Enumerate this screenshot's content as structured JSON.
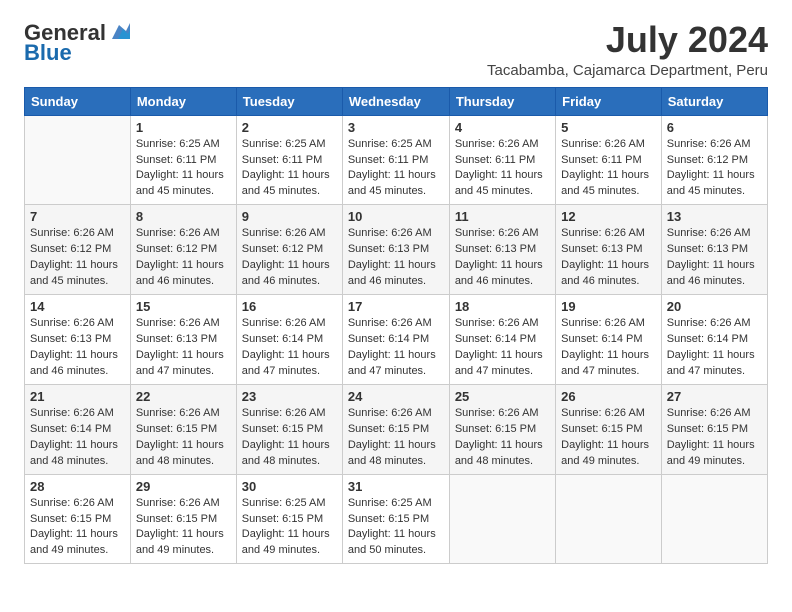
{
  "logo": {
    "general": "General",
    "blue": "Blue"
  },
  "title": {
    "month_year": "July 2024",
    "location": "Tacabamba, Cajamarca Department, Peru"
  },
  "header_days": [
    "Sunday",
    "Monday",
    "Tuesday",
    "Wednesday",
    "Thursday",
    "Friday",
    "Saturday"
  ],
  "weeks": [
    [
      {
        "day": "",
        "sunrise": "",
        "sunset": "",
        "daylight": ""
      },
      {
        "day": "1",
        "sunrise": "Sunrise: 6:25 AM",
        "sunset": "Sunset: 6:11 PM",
        "daylight": "Daylight: 11 hours and 45 minutes."
      },
      {
        "day": "2",
        "sunrise": "Sunrise: 6:25 AM",
        "sunset": "Sunset: 6:11 PM",
        "daylight": "Daylight: 11 hours and 45 minutes."
      },
      {
        "day": "3",
        "sunrise": "Sunrise: 6:25 AM",
        "sunset": "Sunset: 6:11 PM",
        "daylight": "Daylight: 11 hours and 45 minutes."
      },
      {
        "day": "4",
        "sunrise": "Sunrise: 6:26 AM",
        "sunset": "Sunset: 6:11 PM",
        "daylight": "Daylight: 11 hours and 45 minutes."
      },
      {
        "day": "5",
        "sunrise": "Sunrise: 6:26 AM",
        "sunset": "Sunset: 6:11 PM",
        "daylight": "Daylight: 11 hours and 45 minutes."
      },
      {
        "day": "6",
        "sunrise": "Sunrise: 6:26 AM",
        "sunset": "Sunset: 6:12 PM",
        "daylight": "Daylight: 11 hours and 45 minutes."
      }
    ],
    [
      {
        "day": "7",
        "sunrise": "Sunrise: 6:26 AM",
        "sunset": "Sunset: 6:12 PM",
        "daylight": "Daylight: 11 hours and 45 minutes."
      },
      {
        "day": "8",
        "sunrise": "Sunrise: 6:26 AM",
        "sunset": "Sunset: 6:12 PM",
        "daylight": "Daylight: 11 hours and 46 minutes."
      },
      {
        "day": "9",
        "sunrise": "Sunrise: 6:26 AM",
        "sunset": "Sunset: 6:12 PM",
        "daylight": "Daylight: 11 hours and 46 minutes."
      },
      {
        "day": "10",
        "sunrise": "Sunrise: 6:26 AM",
        "sunset": "Sunset: 6:13 PM",
        "daylight": "Daylight: 11 hours and 46 minutes."
      },
      {
        "day": "11",
        "sunrise": "Sunrise: 6:26 AM",
        "sunset": "Sunset: 6:13 PM",
        "daylight": "Daylight: 11 hours and 46 minutes."
      },
      {
        "day": "12",
        "sunrise": "Sunrise: 6:26 AM",
        "sunset": "Sunset: 6:13 PM",
        "daylight": "Daylight: 11 hours and 46 minutes."
      },
      {
        "day": "13",
        "sunrise": "Sunrise: 6:26 AM",
        "sunset": "Sunset: 6:13 PM",
        "daylight": "Daylight: 11 hours and 46 minutes."
      }
    ],
    [
      {
        "day": "14",
        "sunrise": "Sunrise: 6:26 AM",
        "sunset": "Sunset: 6:13 PM",
        "daylight": "Daylight: 11 hours and 46 minutes."
      },
      {
        "day": "15",
        "sunrise": "Sunrise: 6:26 AM",
        "sunset": "Sunset: 6:13 PM",
        "daylight": "Daylight: 11 hours and 47 minutes."
      },
      {
        "day": "16",
        "sunrise": "Sunrise: 6:26 AM",
        "sunset": "Sunset: 6:14 PM",
        "daylight": "Daylight: 11 hours and 47 minutes."
      },
      {
        "day": "17",
        "sunrise": "Sunrise: 6:26 AM",
        "sunset": "Sunset: 6:14 PM",
        "daylight": "Daylight: 11 hours and 47 minutes."
      },
      {
        "day": "18",
        "sunrise": "Sunrise: 6:26 AM",
        "sunset": "Sunset: 6:14 PM",
        "daylight": "Daylight: 11 hours and 47 minutes."
      },
      {
        "day": "19",
        "sunrise": "Sunrise: 6:26 AM",
        "sunset": "Sunset: 6:14 PM",
        "daylight": "Daylight: 11 hours and 47 minutes."
      },
      {
        "day": "20",
        "sunrise": "Sunrise: 6:26 AM",
        "sunset": "Sunset: 6:14 PM",
        "daylight": "Daylight: 11 hours and 47 minutes."
      }
    ],
    [
      {
        "day": "21",
        "sunrise": "Sunrise: 6:26 AM",
        "sunset": "Sunset: 6:14 PM",
        "daylight": "Daylight: 11 hours and 48 minutes."
      },
      {
        "day": "22",
        "sunrise": "Sunrise: 6:26 AM",
        "sunset": "Sunset: 6:15 PM",
        "daylight": "Daylight: 11 hours and 48 minutes."
      },
      {
        "day": "23",
        "sunrise": "Sunrise: 6:26 AM",
        "sunset": "Sunset: 6:15 PM",
        "daylight": "Daylight: 11 hours and 48 minutes."
      },
      {
        "day": "24",
        "sunrise": "Sunrise: 6:26 AM",
        "sunset": "Sunset: 6:15 PM",
        "daylight": "Daylight: 11 hours and 48 minutes."
      },
      {
        "day": "25",
        "sunrise": "Sunrise: 6:26 AM",
        "sunset": "Sunset: 6:15 PM",
        "daylight": "Daylight: 11 hours and 48 minutes."
      },
      {
        "day": "26",
        "sunrise": "Sunrise: 6:26 AM",
        "sunset": "Sunset: 6:15 PM",
        "daylight": "Daylight: 11 hours and 49 minutes."
      },
      {
        "day": "27",
        "sunrise": "Sunrise: 6:26 AM",
        "sunset": "Sunset: 6:15 PM",
        "daylight": "Daylight: 11 hours and 49 minutes."
      }
    ],
    [
      {
        "day": "28",
        "sunrise": "Sunrise: 6:26 AM",
        "sunset": "Sunset: 6:15 PM",
        "daylight": "Daylight: 11 hours and 49 minutes."
      },
      {
        "day": "29",
        "sunrise": "Sunrise: 6:26 AM",
        "sunset": "Sunset: 6:15 PM",
        "daylight": "Daylight: 11 hours and 49 minutes."
      },
      {
        "day": "30",
        "sunrise": "Sunrise: 6:25 AM",
        "sunset": "Sunset: 6:15 PM",
        "daylight": "Daylight: 11 hours and 49 minutes."
      },
      {
        "day": "31",
        "sunrise": "Sunrise: 6:25 AM",
        "sunset": "Sunset: 6:15 PM",
        "daylight": "Daylight: 11 hours and 50 minutes."
      },
      {
        "day": "",
        "sunrise": "",
        "sunset": "",
        "daylight": ""
      },
      {
        "day": "",
        "sunrise": "",
        "sunset": "",
        "daylight": ""
      },
      {
        "day": "",
        "sunrise": "",
        "sunset": "",
        "daylight": ""
      }
    ]
  ]
}
